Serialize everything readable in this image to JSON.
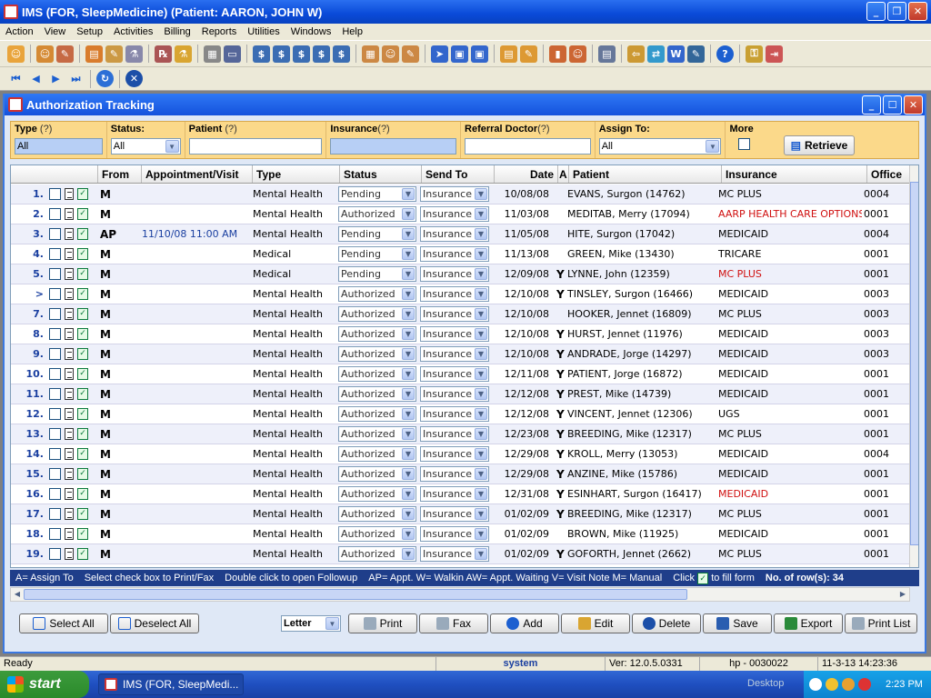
{
  "app": {
    "title": "IMS (FOR, SleepMedicine)     (Patient: AARON, JOHN W)"
  },
  "menu": [
    "Action",
    "View",
    "Setup",
    "Activities",
    "Billing",
    "Reports",
    "Utilities",
    "Windows",
    "Help"
  ],
  "child": {
    "title": "Authorization Tracking"
  },
  "filters": {
    "type_label": "Type",
    "type_value": "All",
    "status_label": "Status:",
    "status_value": "All",
    "patient_label": "Patient",
    "patient_value": "",
    "insurance_label": "Insurance",
    "insurance_value": "",
    "ref_label": "Referral Doctor",
    "ref_value": "",
    "assign_label": "Assign To:",
    "assign_value": "All",
    "more_label": "More",
    "q": "(?)",
    "retrieve": "Retrieve"
  },
  "columns": [
    "From",
    "Appointment/Visit",
    "Type",
    "Status",
    "Send To",
    "Date",
    "A",
    "Patient",
    "Insurance",
    "Office"
  ],
  "rows": [
    {
      "n": "1.",
      "from": "M",
      "appt": "",
      "type": "Mental Health",
      "status": "Pending",
      "send": "Insurance",
      "date": "10/08/08",
      "a": "",
      "patient": "EVANS, Surgon   (14762)",
      "ins": "MC PLUS",
      "ins_red": false,
      "office": "0004"
    },
    {
      "n": "2.",
      "from": "M",
      "appt": "",
      "type": "Mental Health",
      "status": "Authorized",
      "send": "Insurance",
      "date": "11/03/08",
      "a": "",
      "patient": "MEDITAB, Merry   (17094)",
      "ins": "AARP HEALTH CARE OPTIONS",
      "ins_red": true,
      "office": "0001"
    },
    {
      "n": "3.",
      "from": "AP",
      "appt": "11/10/08 11:00 AM",
      "type": "Mental Health",
      "status": "Pending",
      "send": "Insurance",
      "date": "11/05/08",
      "a": "",
      "patient": "HITE, Surgon   (17042)",
      "ins": "MEDICAID",
      "ins_red": false,
      "office": "0004"
    },
    {
      "n": "4.",
      "from": "M",
      "appt": "",
      "type": "Medical",
      "status": "Pending",
      "send": "Insurance",
      "date": "11/13/08",
      "a": "",
      "patient": "GREEN, Mike   (13430)",
      "ins": "TRICARE",
      "ins_red": false,
      "office": "0001"
    },
    {
      "n": "5.",
      "from": "M",
      "appt": "",
      "type": "Medical",
      "status": "Pending",
      "send": "Insurance",
      "date": "12/09/08",
      "a": "Y",
      "patient": "LYNNE, John   (12359)",
      "ins": "MC PLUS",
      "ins_red": true,
      "office": "0001"
    },
    {
      "n": ">",
      "from": "M",
      "appt": "",
      "type": "Mental Health",
      "status": "Authorized",
      "send": "Insurance",
      "date": "12/10/08",
      "a": "Y",
      "patient": "TINSLEY, Surgon   (16466)",
      "ins": "MEDICAID",
      "ins_red": false,
      "office": "0003"
    },
    {
      "n": "7.",
      "from": "M",
      "appt": "",
      "type": "Mental Health",
      "status": "Authorized",
      "send": "Insurance",
      "date": "12/10/08",
      "a": "",
      "patient": "HOOKER, Jennet   (16809)",
      "ins": "MC PLUS",
      "ins_red": false,
      "office": "0003"
    },
    {
      "n": "8.",
      "from": "M",
      "appt": "",
      "type": "Mental Health",
      "status": "Authorized",
      "send": "Insurance",
      "date": "12/10/08",
      "a": "Y",
      "patient": "HURST, Jennet   (11976)",
      "ins": "MEDICAID",
      "ins_red": false,
      "office": "0003"
    },
    {
      "n": "9.",
      "from": "M",
      "appt": "",
      "type": "Mental Health",
      "status": "Authorized",
      "send": "Insurance",
      "date": "12/10/08",
      "a": "Y",
      "patient": "ANDRADE, Jorge   (14297)",
      "ins": "MEDICAID",
      "ins_red": false,
      "office": "0003"
    },
    {
      "n": "10.",
      "from": "M",
      "appt": "",
      "type": "Mental Health",
      "status": "Authorized",
      "send": "Insurance",
      "date": "12/11/08",
      "a": "Y",
      "patient": "PATIENT, Jorge   (16872)",
      "ins": "MEDICAID",
      "ins_red": false,
      "office": "0001"
    },
    {
      "n": "11.",
      "from": "M",
      "appt": "",
      "type": "Mental Health",
      "status": "Authorized",
      "send": "Insurance",
      "date": "12/12/08",
      "a": "Y",
      "patient": "PREST, Mike   (14739)",
      "ins": "MEDICAID",
      "ins_red": false,
      "office": "0001"
    },
    {
      "n": "12.",
      "from": "M",
      "appt": "",
      "type": "Mental Health",
      "status": "Authorized",
      "send": "Insurance",
      "date": "12/12/08",
      "a": "Y",
      "patient": "VINCENT, Jennet   (12306)",
      "ins": "UGS",
      "ins_red": false,
      "office": "0001"
    },
    {
      "n": "13.",
      "from": "M",
      "appt": "",
      "type": "Mental Health",
      "status": "Authorized",
      "send": "Insurance",
      "date": "12/23/08",
      "a": "Y",
      "patient": "BREEDING, Mike   (12317)",
      "ins": "MC PLUS",
      "ins_red": false,
      "office": "0001"
    },
    {
      "n": "14.",
      "from": "M",
      "appt": "",
      "type": "Mental Health",
      "status": "Authorized",
      "send": "Insurance",
      "date": "12/29/08",
      "a": "Y",
      "patient": "KROLL, Merry   (13053)",
      "ins": "MEDICAID",
      "ins_red": false,
      "office": "0004"
    },
    {
      "n": "15.",
      "from": "M",
      "appt": "",
      "type": "Mental Health",
      "status": "Authorized",
      "send": "Insurance",
      "date": "12/29/08",
      "a": "Y",
      "patient": "ANZINE, Mike   (15786)",
      "ins": "MEDICAID",
      "ins_red": false,
      "office": "0001"
    },
    {
      "n": "16.",
      "from": "M",
      "appt": "",
      "type": "Mental Health",
      "status": "Authorized",
      "send": "Insurance",
      "date": "12/31/08",
      "a": "Y",
      "patient": "ESINHART, Surgon   (16417)",
      "ins": "MEDICAID",
      "ins_red": true,
      "office": "0001"
    },
    {
      "n": "17.",
      "from": "M",
      "appt": "",
      "type": "Mental Health",
      "status": "Authorized",
      "send": "Insurance",
      "date": "01/02/09",
      "a": "Y",
      "patient": "BREEDING, Mike   (12317)",
      "ins": "MC PLUS",
      "ins_red": false,
      "office": "0001"
    },
    {
      "n": "18.",
      "from": "M",
      "appt": "",
      "type": "Mental Health",
      "status": "Authorized",
      "send": "Insurance",
      "date": "01/02/09",
      "a": "",
      "patient": "BROWN, Mike   (11925)",
      "ins": "MEDICAID",
      "ins_red": false,
      "office": "0001"
    },
    {
      "n": "19.",
      "from": "M",
      "appt": "",
      "type": "Mental Health",
      "status": "Authorized",
      "send": "Insurance",
      "date": "01/02/09",
      "a": "Y",
      "patient": "GOFORTH, Jennet   (2662)",
      "ins": "MC PLUS",
      "ins_red": false,
      "office": "0001"
    }
  ],
  "legend": {
    "assign": "A= Assign To",
    "select": "Select check box to Print/Fax",
    "dbl": "Double click to open Followup",
    "codes": "AP= Appt. W= Walkin  AW= Appt. Waiting  V= Visit Note  M= Manual",
    "click": "Click",
    "fill": "to fill form",
    "rows": "No. of row(s): 34"
  },
  "buttons": {
    "select_all": "Select All",
    "deselect_all": "Deselect All",
    "paper": "Letter",
    "print": "Print",
    "fax": "Fax",
    "add": "Add",
    "edit": "Edit",
    "delete": "Delete",
    "save": "Save",
    "export": "Export",
    "print_list": "Print List"
  },
  "status": {
    "ready": "Ready",
    "user": "system",
    "ver": "Ver: 12.0.5.0331",
    "host": "hp - 0030022",
    "datetime": "11-3-13 14:23:36"
  },
  "taskbar": {
    "start": "start",
    "task": "IMS (FOR, SleepMedi...",
    "desktop": "Desktop",
    "time": "2:23 PM"
  }
}
